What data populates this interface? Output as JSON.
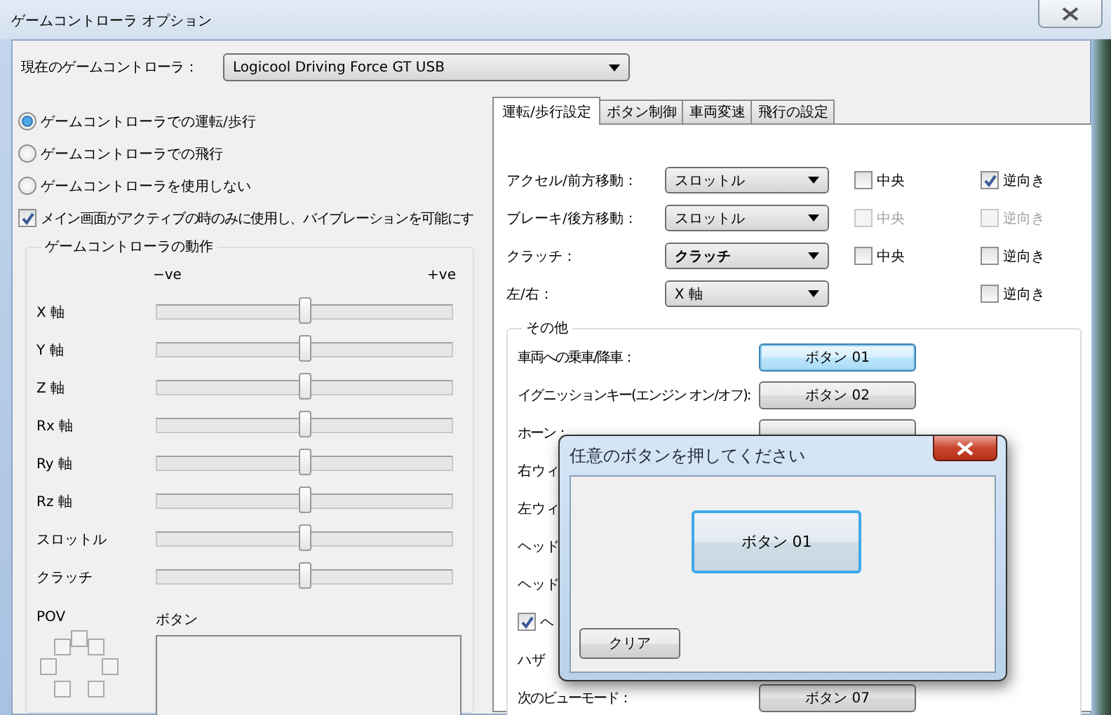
{
  "window": {
    "title": "ゲームコントローラ オプション"
  },
  "controller": {
    "label": "現在のゲームコントローラ：",
    "value": "Logicool Driving Force GT USB"
  },
  "modes": [
    {
      "label": "ゲームコントローラでの運転/歩行",
      "selected": true
    },
    {
      "label": "ゲームコントローラでの飛行",
      "selected": false
    },
    {
      "label": "ゲームコントローラを使用しない",
      "selected": false
    }
  ],
  "vibration": {
    "label": "メイン画面がアクティブの時のみに使用し、バイブレーションを可能にす",
    "checked": true
  },
  "axes_group": {
    "title": "ゲームコントローラの動作",
    "min_label": "−ve",
    "max_label": "+ve",
    "axes": [
      {
        "name": "X 軸",
        "level": 0.5
      },
      {
        "name": "Y 軸",
        "level": 0.5
      },
      {
        "name": "Z 軸",
        "level": 0.5
      },
      {
        "name": "Rx 軸",
        "level": 0.5
      },
      {
        "name": "Ry 軸",
        "level": 0.5
      },
      {
        "name": "Rz 軸",
        "level": 0.5
      },
      {
        "name": "スロットル",
        "level": 0.5
      },
      {
        "name": "クラッチ",
        "level": 0.5
      }
    ]
  },
  "pov": {
    "label": "POV"
  },
  "buttons_panel": {
    "label": "ボタン"
  },
  "tabs": [
    {
      "label": "運転/歩行設定",
      "selected": true
    },
    {
      "label": "ボタン制御",
      "selected": false
    },
    {
      "label": "車両変速",
      "selected": false
    },
    {
      "label": "飛行の設定",
      "selected": false
    }
  ],
  "drive_settings": [
    {
      "label": "アクセル/前方移動：",
      "value": "スロットル",
      "bold": false,
      "center": {
        "label": "中央",
        "checked": false,
        "disabled": false
      },
      "reverse": {
        "label": "逆向き",
        "checked": true,
        "disabled": false
      }
    },
    {
      "label": "ブレーキ/後方移動：",
      "value": "スロットル",
      "bold": false,
      "center": {
        "label": "中央",
        "checked": false,
        "disabled": true
      },
      "reverse": {
        "label": "逆向き",
        "checked": false,
        "disabled": true
      }
    },
    {
      "label": "クラッチ：",
      "value": "クラッチ",
      "bold": true,
      "center": {
        "label": "中央",
        "checked": false,
        "disabled": false
      },
      "reverse": {
        "label": "逆向き",
        "checked": false,
        "disabled": false
      }
    },
    {
      "label": "左/右：",
      "value": "X 軸",
      "bold": false,
      "reverse": {
        "label": "逆向き",
        "checked": false,
        "disabled": false
      }
    }
  ],
  "other": {
    "title": "その他",
    "rows": [
      {
        "kind": "button",
        "label": "車両への乗車/降車：",
        "button": "ボタン 01",
        "focused": true
      },
      {
        "kind": "button",
        "label": "イグニッションキー(エンジン オン/オフ):",
        "button": "ボタン 02",
        "focused": false
      },
      {
        "kind": "covered",
        "label": "ホーン："
      },
      {
        "kind": "partial",
        "label": "右ウィ"
      },
      {
        "kind": "partial",
        "label": "左ウィ"
      },
      {
        "kind": "partial",
        "label": "ヘッド"
      },
      {
        "kind": "partial",
        "label": "ヘッド"
      },
      {
        "kind": "check",
        "label": "ヘ",
        "checked": true
      },
      {
        "kind": "partial",
        "label": "ハザ"
      },
      {
        "kind": "button",
        "label": "次のビューモード：",
        "button": "ボタン 07",
        "focused": false
      }
    ]
  },
  "dialog": {
    "title": "任意のボタンを押してください",
    "pressed": "ボタン 01",
    "clear": "クリア"
  }
}
